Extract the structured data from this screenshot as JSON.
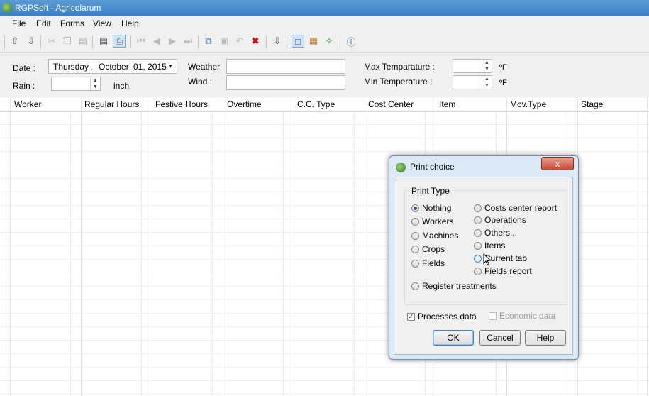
{
  "window": {
    "title": "RGPSoft - Agricolarum"
  },
  "menu": [
    "File",
    "Edit",
    "Forms",
    "View",
    "Help"
  ],
  "toolbar_icons": [
    "arrow-up-icon",
    "arrow-down-icon",
    "cut-icon",
    "copy-icon",
    "paste-icon",
    "print-preview-icon",
    "print-icon",
    "nav-first-icon",
    "nav-prev-icon",
    "nav-next-icon",
    "nav-last-icon",
    "duplicate-icon",
    "save-icon",
    "undo-icon",
    "delete-icon",
    "download-icon",
    "page-icon",
    "calendar-icon",
    "tools-icon",
    "help-icon"
  ],
  "form": {
    "date_label": "Date :",
    "date_day": "Thursday",
    "date_sep": ",",
    "date_month": "October",
    "date_daynum": "01, 2015",
    "rain_label": "Rain :",
    "rain_value": "",
    "rain_unit": "inch",
    "weather_label": "Weather",
    "weather_value": "",
    "wind_label": "Wind :",
    "wind_value": "",
    "max_temp_label": "Max Temparature :",
    "max_temp_value": "",
    "min_temp_label": "Min Temperature :",
    "min_temp_value": "",
    "temp_unit": "ºF"
  },
  "grid": {
    "columns": [
      "Worker",
      "Regular Hours",
      "Festive Hours",
      "Overtime",
      "C.C. Type",
      "Cost Center",
      "Item",
      "Mov.Type",
      "Stage"
    ]
  },
  "dialog": {
    "title": "Print choice",
    "group_label": "Print Type",
    "options_left": [
      "Nothing",
      "Workers",
      "Machines",
      "Crops",
      "Fields"
    ],
    "options_right": [
      "Costs center report",
      "Operations",
      "Others...",
      "Items",
      "Current tab",
      "Fields report"
    ],
    "option_bottom": "Register treatments",
    "selected": "Nothing",
    "processes_data": "Processes data",
    "economic_data": "Economic data",
    "ok": "OK",
    "cancel": "Cancel",
    "help": "Help",
    "close_glyph": "x"
  }
}
